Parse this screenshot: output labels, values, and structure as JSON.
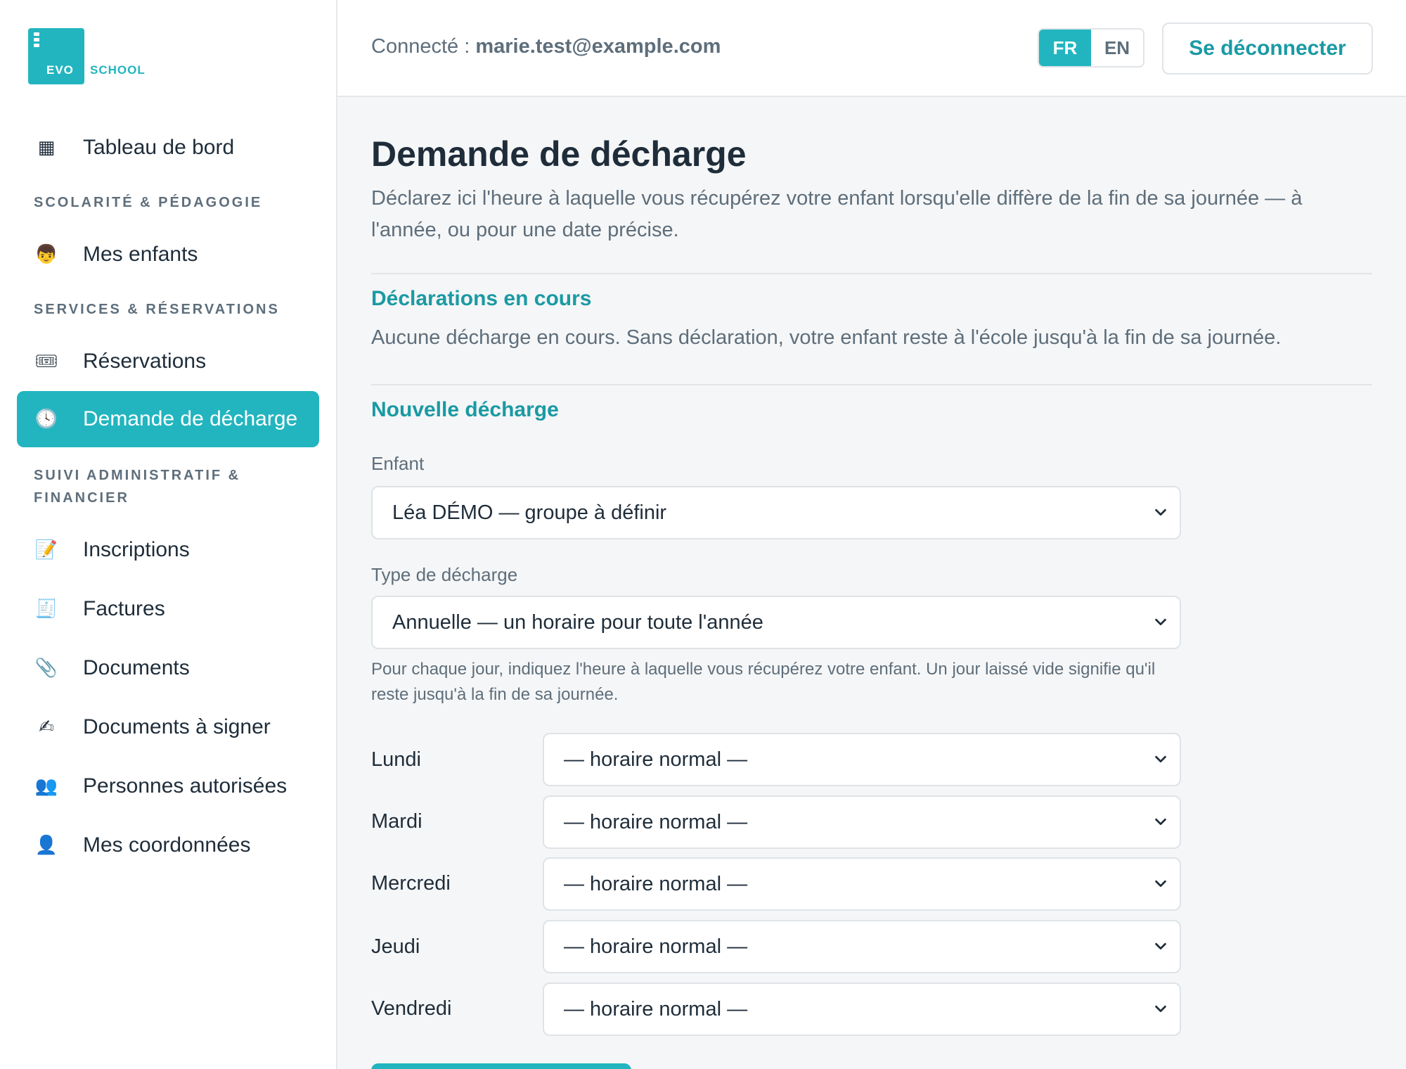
{
  "app": {
    "logo_left": "EVO",
    "logo_right": "SCHOOL",
    "brand_color": "#22b5bf"
  },
  "header": {
    "connected_label": "Connecté :",
    "user_email": "marie.test@example.com",
    "lang_fr": "FR",
    "lang_en": "EN",
    "logout_label": "Se déconnecter"
  },
  "sidebar": {
    "dashboard": {
      "label": "Tableau de bord",
      "icon": "▦"
    },
    "section_scolarite": "SCOLARITÉ & PÉDAGOGIE",
    "children": {
      "label": "Mes enfants",
      "icon": "👦"
    },
    "section_services": "SERVICES & RÉSERVATIONS",
    "reservations": {
      "label": "Réservations",
      "icon": "🎟"
    },
    "decharge": {
      "label": "Demande de décharge",
      "icon": "🕓"
    },
    "section_admin": "SUIVI ADMINISTRATIF & FINANCIER",
    "inscriptions": {
      "label": "Inscriptions",
      "icon": "📝"
    },
    "factures": {
      "label": "Factures",
      "icon": "🧾"
    },
    "documents": {
      "label": "Documents",
      "icon": "📎"
    },
    "documents_signer": {
      "label": "Documents à signer",
      "icon": "✍"
    },
    "personnes": {
      "label": "Personnes autorisées",
      "icon": "👥"
    },
    "coordonnees": {
      "label": "Mes coordonnées",
      "icon": "👤"
    }
  },
  "main": {
    "title": "Demande de décharge",
    "description": "Déclarez ici l'heure à laquelle vous récupérez votre enfant lorsqu'elle diffère de la fin de sa journée — à l'année, ou pour une date précise.",
    "current_title": "Déclarations en cours",
    "current_empty": "Aucune décharge en cours. Sans déclaration, votre enfant reste à l'école jusqu'à la fin de sa journée.",
    "new_title": "Nouvelle décharge",
    "child_label": "Enfant",
    "child_value": "Léa DÉMO — groupe à définir",
    "type_label": "Type de décharge",
    "type_value": "Annuelle — un horaire pour toute l'année",
    "hint": "Pour chaque jour, indiquez l'heure à laquelle vous récupérez votre enfant. Un jour laissé vide signifie qu'il reste jusqu'à la fin de sa journée.",
    "days": [
      {
        "label": "Lundi",
        "value": "— horaire normal —"
      },
      {
        "label": "Mardi",
        "value": "— horaire normal —"
      },
      {
        "label": "Mercredi",
        "value": "— horaire normal —"
      },
      {
        "label": "Jeudi",
        "value": "— horaire normal —"
      },
      {
        "label": "Vendredi",
        "value": "— horaire normal —"
      }
    ]
  }
}
